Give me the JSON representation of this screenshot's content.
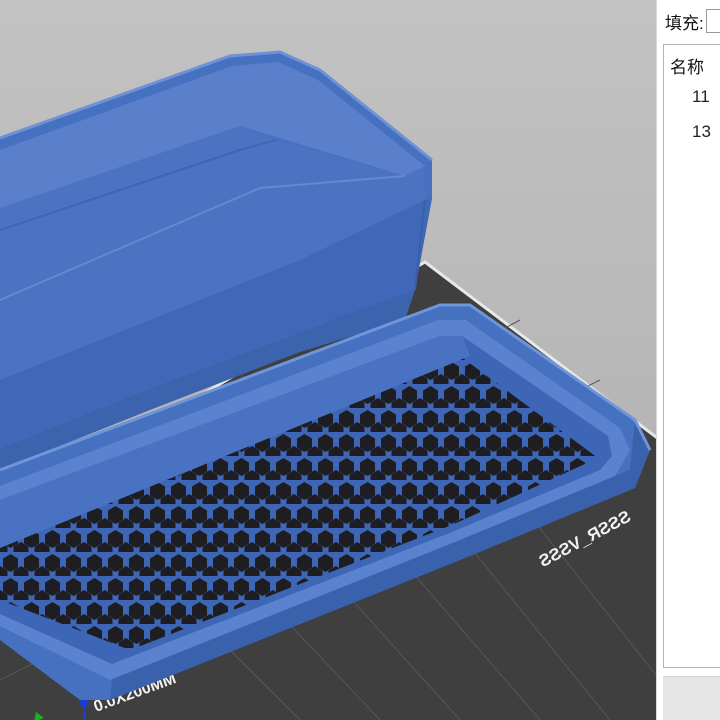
{
  "panel": {
    "fill_label": "填充:",
    "fill_select_value": "",
    "list_header": "名称",
    "rows": [
      {
        "label": "11"
      },
      {
        "label": "13"
      }
    ]
  },
  "viewport": {
    "bed_label_bottom": "0.0X200MM",
    "bed_label_right": "SSSR_VSSS",
    "model_color": "#4a74c4",
    "bed_color": "#3f3f3f"
  }
}
